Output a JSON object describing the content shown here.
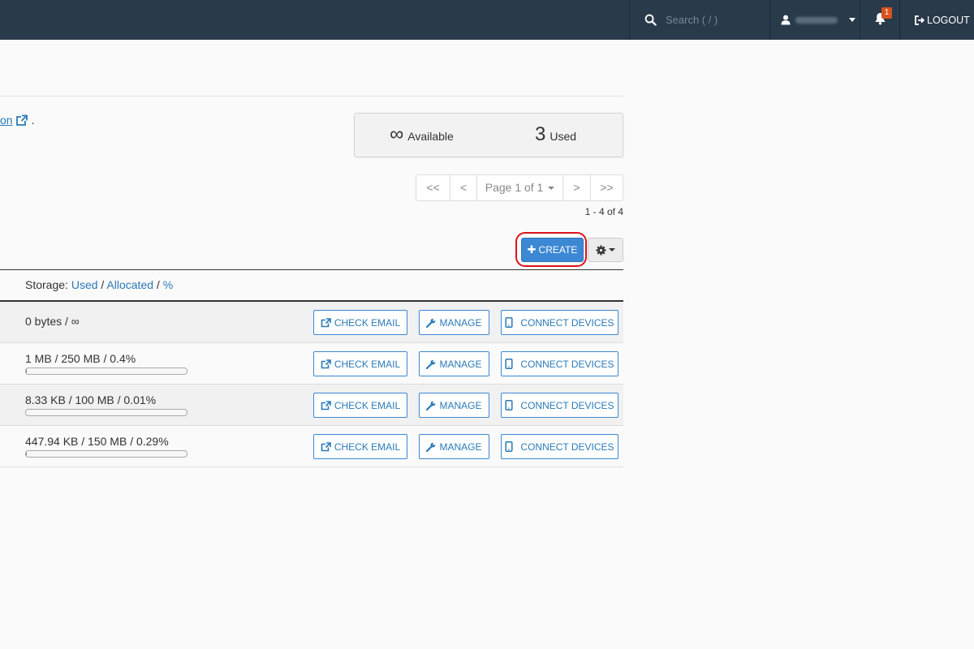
{
  "header": {
    "search_placeholder": "Search ( / )",
    "notification_count": "1",
    "logout_label": "LOGOUT"
  },
  "intro": {
    "link_text": "on",
    "trailing": "."
  },
  "stats": {
    "available_value": "∞",
    "available_label": "Available",
    "used_value": "3",
    "used_label": "Used"
  },
  "pager": {
    "first": "<<",
    "prev": "<",
    "page_label": "Page 1 of 1",
    "next": ">",
    "last": ">>",
    "range": "1 - 4 of 4"
  },
  "toolbar": {
    "create_label": "CREATE"
  },
  "table": {
    "storage_label": "Storage:",
    "sort_used": "Used",
    "sort_allocated": "Allocated",
    "sort_percent": "%",
    "sep": "/",
    "actions": {
      "check_email": "CHECK EMAIL",
      "manage": "MANAGE",
      "connect_devices": "CONNECT DEVICES"
    },
    "rows": [
      {
        "storage": "0 bytes / ∞",
        "usage_fraction": null
      },
      {
        "storage": "1 MB / 250 MB / 0.4%",
        "usage_fraction": 0.004
      },
      {
        "storage": "8.33 KB / 100 MB / 0.01%",
        "usage_fraction": 0.0001
      },
      {
        "storage": "447.94 KB / 150 MB / 0.29%",
        "usage_fraction": 0.0029
      }
    ]
  },
  "colors": {
    "topbar": "#293a4a",
    "accent": "#3c88d4",
    "highlight": "#d9151c",
    "badge": "#d9531e"
  }
}
